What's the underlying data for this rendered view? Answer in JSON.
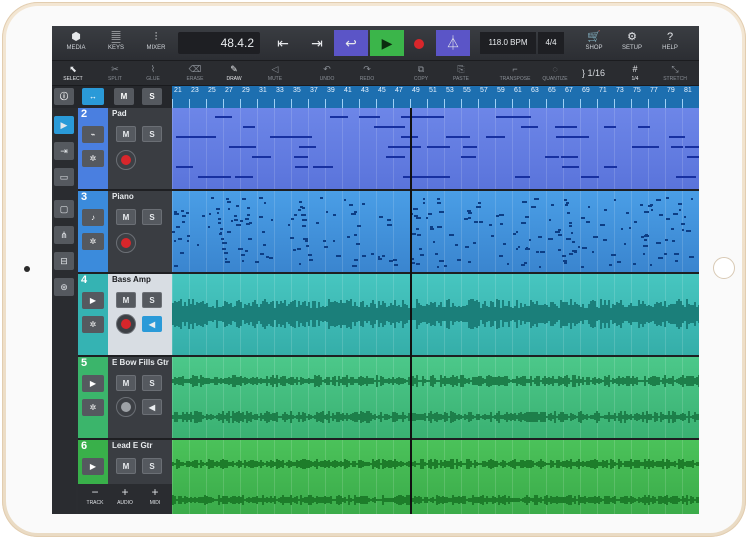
{
  "toolbar": {
    "media": "MEDIA",
    "keys": "KEYS",
    "mixer": "MIXER",
    "position": "48.4.2",
    "tempo": "118.0 BPM",
    "signature": "4/4",
    "shop": "SHOP",
    "setup": "SETUP",
    "help": "HELP"
  },
  "tools": {
    "select": "SELECT",
    "split": "SPLIT",
    "glue": "GLUE",
    "erase": "ERASE",
    "draw": "DRAW",
    "mute": "MUTE",
    "undo": "UNDO",
    "redo": "REDO",
    "copy": "COPY",
    "paste": "PASTE",
    "transpose": "TRANSPOSE",
    "quantize": "QUANTIZE",
    "quantize_value": "1/16",
    "grid_value": "1/4",
    "stretch": "STRETCH"
  },
  "ruler": {
    "bars": [
      "21",
      "23",
      "25",
      "27",
      "29",
      "31",
      "33",
      "35",
      "37",
      "39",
      "41",
      "43",
      "45",
      "47",
      "49",
      "51",
      "53",
      "55",
      "57",
      "59",
      "61",
      "63",
      "65",
      "67",
      "69",
      "71",
      "73",
      "75",
      "77",
      "79",
      "81"
    ],
    "mute_label": "M",
    "solo_label": "S"
  },
  "tracks": [
    {
      "number": "2",
      "name": "Pad",
      "color": "#4a7fe0",
      "type": "instrument",
      "icon": "synth-icon"
    },
    {
      "number": "3",
      "name": "Piano",
      "color": "#3b8bdc",
      "type": "instrument",
      "icon": "piano-icon"
    },
    {
      "number": "4",
      "name": "Bass Amp",
      "color": "#35b3b3",
      "type": "audio",
      "icon": "play-icon"
    },
    {
      "number": "5",
      "name": "E Bow Fills Gtr",
      "color": "#3bb56b",
      "type": "audio",
      "icon": "play-icon"
    },
    {
      "number": "6",
      "name": "Lead E Gtr",
      "color": "#39b04a",
      "type": "audio",
      "icon": "play-icon"
    }
  ],
  "track_buttons": {
    "mute": "M",
    "solo": "S"
  },
  "bottom": {
    "track": "TRACK",
    "audio": "AUDIO",
    "midi": "MIDI"
  },
  "colors": {
    "ruler": "#1d6fb0",
    "loop": "#5b55c7",
    "play": "#3bb54a",
    "record": "#d8262b"
  }
}
